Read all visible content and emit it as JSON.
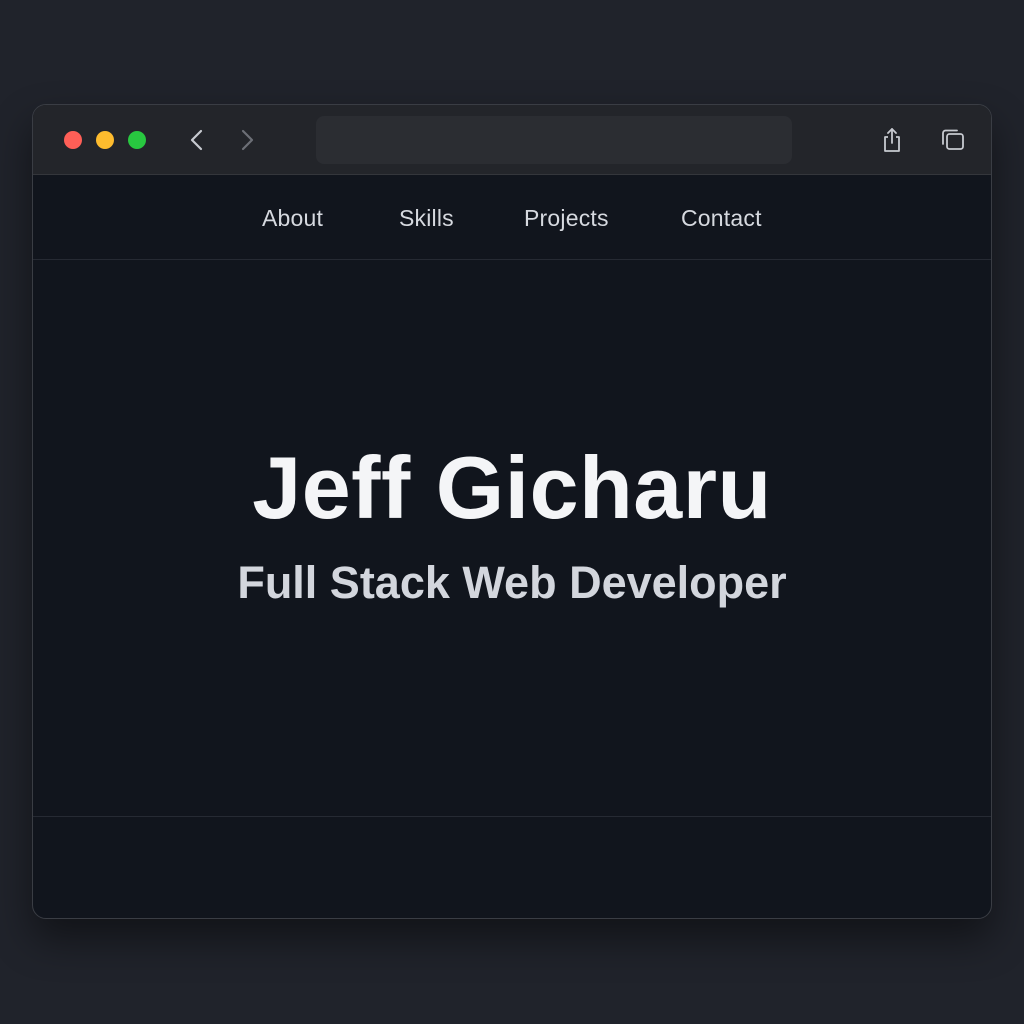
{
  "browser": {
    "address_value": "",
    "traffic_lights": {
      "close": "#ff5f57",
      "minimize": "#febc2e",
      "zoom": "#28c840"
    }
  },
  "site": {
    "nav": [
      "About",
      "Skills",
      "Projects",
      "Contact"
    ],
    "name": "Jeff Gicharu",
    "tagline": "Full Stack Web Developer"
  },
  "colors": {
    "page_background": "#20232b",
    "content_background": "#11151d",
    "titlebar": "#23252a",
    "heading_text": "#f4f5f7",
    "body_text": "#d3d6dd"
  }
}
